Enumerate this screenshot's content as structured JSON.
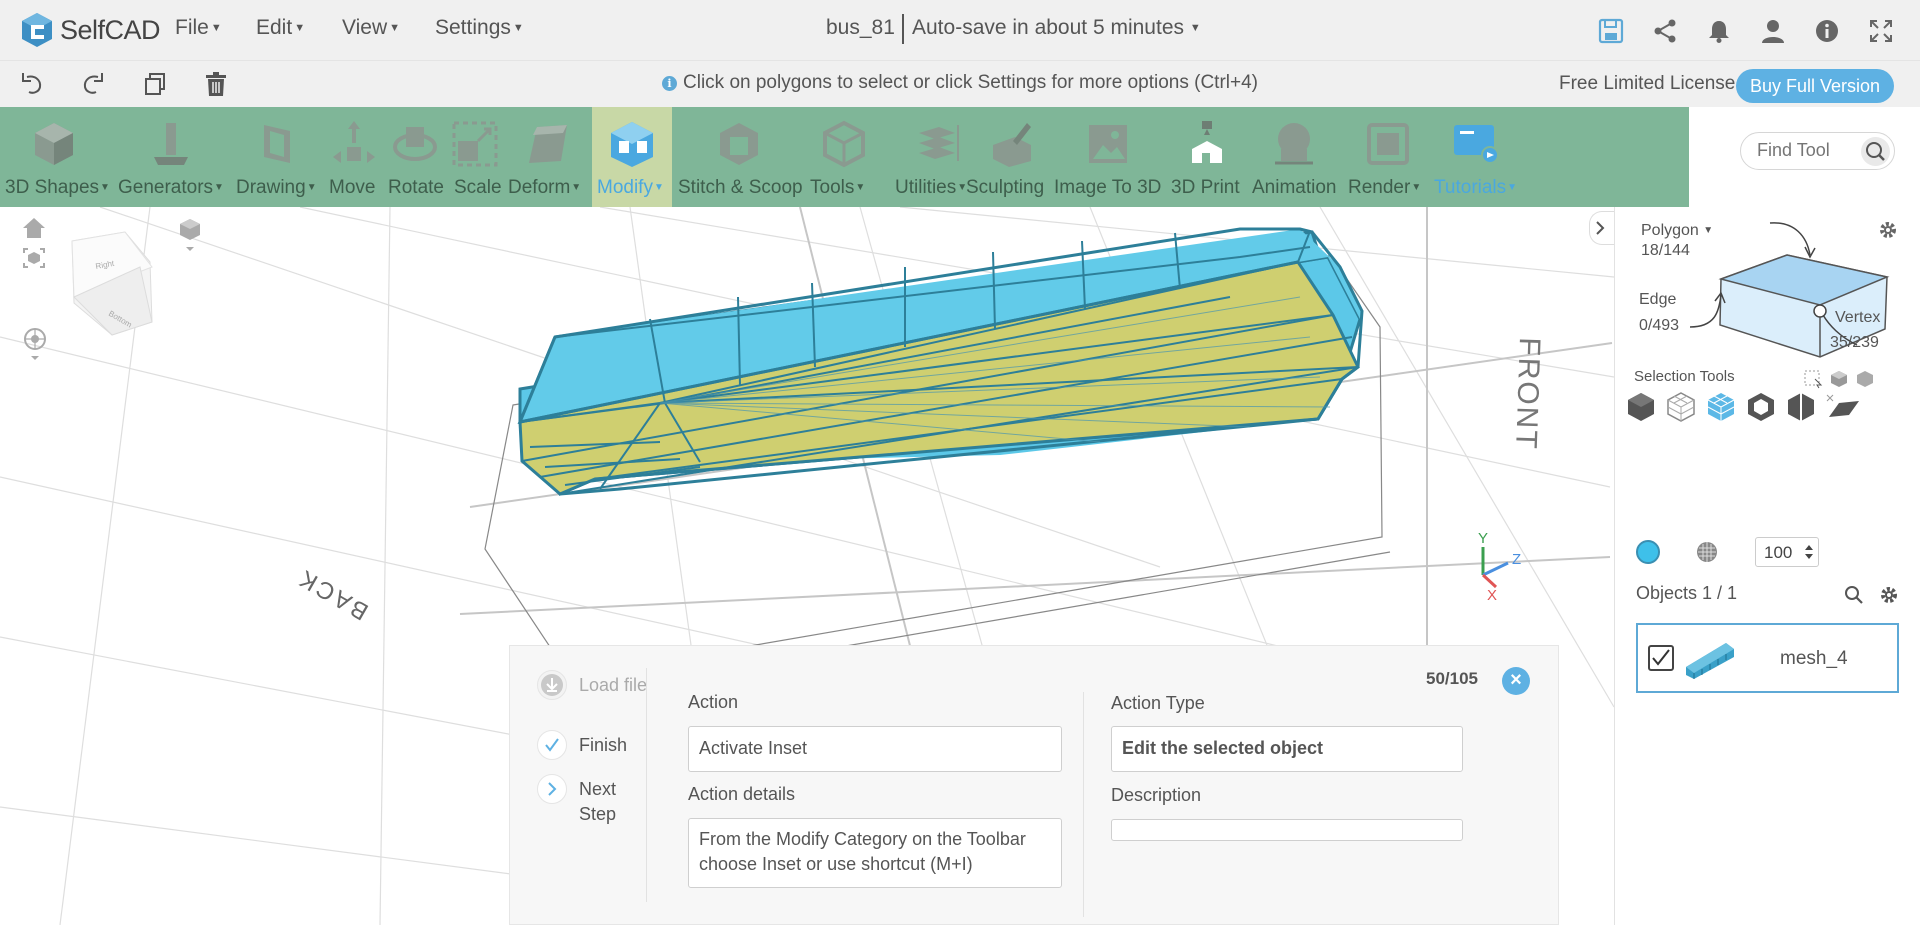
{
  "app": {
    "logo_text": "SelfCAD"
  },
  "menu": {
    "file": "File",
    "edit": "Edit",
    "view": "View",
    "settings": "Settings"
  },
  "doc": {
    "title": "bus_81",
    "autosave": "Auto-save in about 5 minutes"
  },
  "hint": {
    "text": "Click on polygons to select or click Settings for more options (Ctrl+4)"
  },
  "license": {
    "text": "Free Limited License",
    "buy_label": "Buy Full Version"
  },
  "toolbar": {
    "shapes": "3D Shapes",
    "generators": "Generators",
    "drawing": "Drawing",
    "move": "Move",
    "rotate": "Rotate",
    "scale": "Scale",
    "deform": "Deform",
    "modify": "Modify",
    "stitch": "Stitch & Scoop",
    "tools": "Tools",
    "utilities": "Utilities",
    "sculpting": "Sculpting",
    "image3d": "Image To 3D",
    "print": "3D Print",
    "animation": "Animation",
    "render": "Render",
    "tutorials": "Tutorials"
  },
  "find_tool": {
    "placeholder": "Find Tool"
  },
  "viewport": {
    "label_front": "FRONT",
    "label_back": "BACK",
    "axis_y": "Y",
    "axis_z": "Z",
    "axis_x": "X",
    "cube_top": "Right",
    "cube_front": "Bottom"
  },
  "selection": {
    "polygon_label": "Polygon",
    "polygon_count": "18/144",
    "edge_label": "Edge",
    "edge_count": "0/493",
    "vertex_label": "Vertex",
    "vertex_count": "35/239",
    "tools_title": "Selection Tools",
    "opacity": "100"
  },
  "objects": {
    "title": "Objects 1 / 1",
    "items": [
      {
        "name": "mesh_4"
      }
    ]
  },
  "tutorial": {
    "counter": "50/105",
    "steps": {
      "load": "Load file",
      "finish": "Finish",
      "next": "Next Step"
    },
    "action_label": "Action",
    "action_value": "Activate Inset",
    "details_label": "Action details",
    "details_value": "From the Modify Category on the Toolbar choose Inset or use shortcut (M+I)",
    "type_label": "Action Type",
    "type_value": "Edit the selected object",
    "desc_label": "Description",
    "desc_value": ""
  },
  "colors": {
    "toolbar": "#7fb698",
    "accent": "#5eb1e3",
    "mesh_blue": "#5cc8e8",
    "mesh_yellow": "#cfcf70",
    "edge": "#2d7f99"
  }
}
